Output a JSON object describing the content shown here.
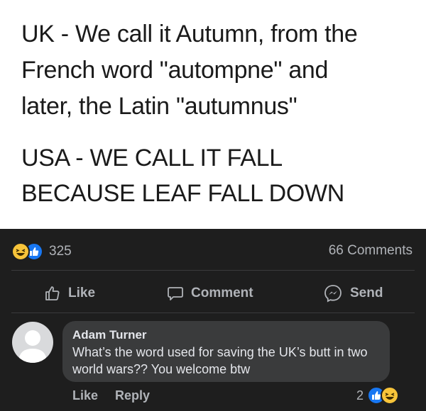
{
  "meme": {
    "line1": "UK - We call it Autumn, from the",
    "line2": "French word \"autompne\" and",
    "line3": "later, the Latin \"autumnus\"",
    "line4": "USA - WE CALL IT FALL",
    "line5": "BECAUSE LEAF FALL DOWN"
  },
  "post": {
    "reaction_count": "325",
    "comments_count": "66 Comments",
    "reaction_icons": [
      "haha-icon",
      "like-icon"
    ]
  },
  "actions": {
    "like": "Like",
    "comment": "Comment",
    "send": "Send"
  },
  "comment": {
    "author": "Adam Turner",
    "text": "What’s the word used for saving the UK’s butt in two world wars?? You welcome btw",
    "like_label": "Like",
    "reply_label": "Reply",
    "reaction_count": "2"
  },
  "colors": {
    "background": "#1e1e1e",
    "bubble": "#3a3b3c",
    "like_blue": "#1877f2",
    "haha_yellow": "#f7c43a"
  }
}
